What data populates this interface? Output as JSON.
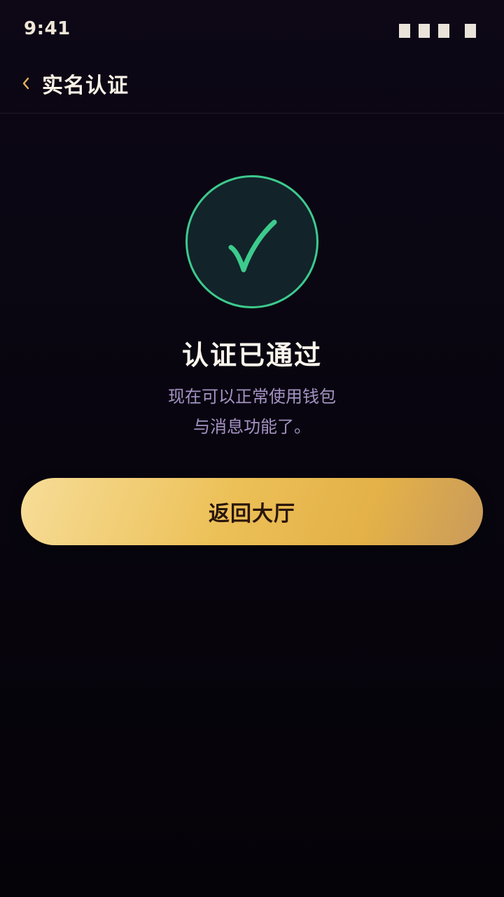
{
  "status_bar": {
    "time": "9:41"
  },
  "nav": {
    "back_icon": "chevron-left-icon",
    "title": "实名认证"
  },
  "result": {
    "icon": "check-icon",
    "title": "认证已通过",
    "description_line1": "现在可以正常使用钱包",
    "description_line2": "与消息功能了。"
  },
  "actions": {
    "primary_label": "返回大厅"
  },
  "colors": {
    "background": "#0b0613",
    "accent_gold": "#ecc057",
    "success_green": "#3dca8d",
    "description_text": "#a593c4"
  }
}
